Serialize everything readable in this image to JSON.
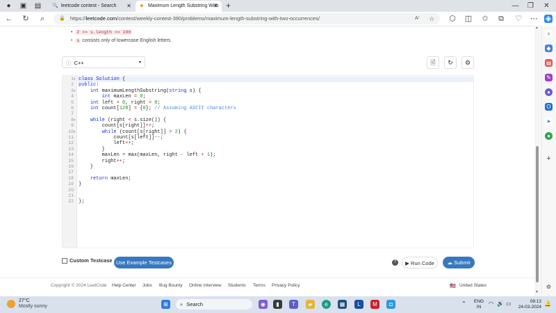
{
  "browser": {
    "tabs": [
      {
        "title": "leetcode contest - Search",
        "close": "✕"
      },
      {
        "title": "Maximum Length Substring With",
        "close": "✕"
      }
    ],
    "new_tab": "+",
    "url_domain": "https://",
    "url_host": "leetcode.com",
    "url_path": "/contest/weekly-contest-390/problems/maximum-length-substring-with-two-occurrences/"
  },
  "problem": {
    "constraint1_code": "2 <= s.length <= 100",
    "constraint2_code": "s",
    "constraint2_text": "consists only of lowercase English letters."
  },
  "editor": {
    "language": "C++",
    "line_numbers": [
      "1",
      "2",
      "3",
      "4",
      "5",
      "6",
      "7",
      "8",
      "9",
      "10",
      "11",
      "12",
      "13",
      "14",
      "15",
      "16",
      "17",
      "18",
      "19",
      "20",
      "21",
      "22"
    ]
  },
  "controls": {
    "custom_testcase": "Custom Testcase",
    "use_example": "Use Example Testcases",
    "run_code": "Run Code",
    "submit": "Submit"
  },
  "footer": {
    "copyright": "Copyright © 2024 LeetCode",
    "links": [
      "Help Center",
      "Jobs",
      "Bug Bounty",
      "Online Interview",
      "Students",
      "Terms",
      "Privacy Policy"
    ],
    "region": "United States"
  },
  "taskbar": {
    "weather_temp": "27°C",
    "weather_desc": "Mostly sunny",
    "search": "Search",
    "lang1": "ENG",
    "lang2": "IN",
    "time": "08:13",
    "date": "24-03-2024"
  },
  "colors": {
    "accent": "#3878c0",
    "keyword": "#1d2fd8",
    "number": "#1b8f1b",
    "comment": "#4c8bd1"
  }
}
